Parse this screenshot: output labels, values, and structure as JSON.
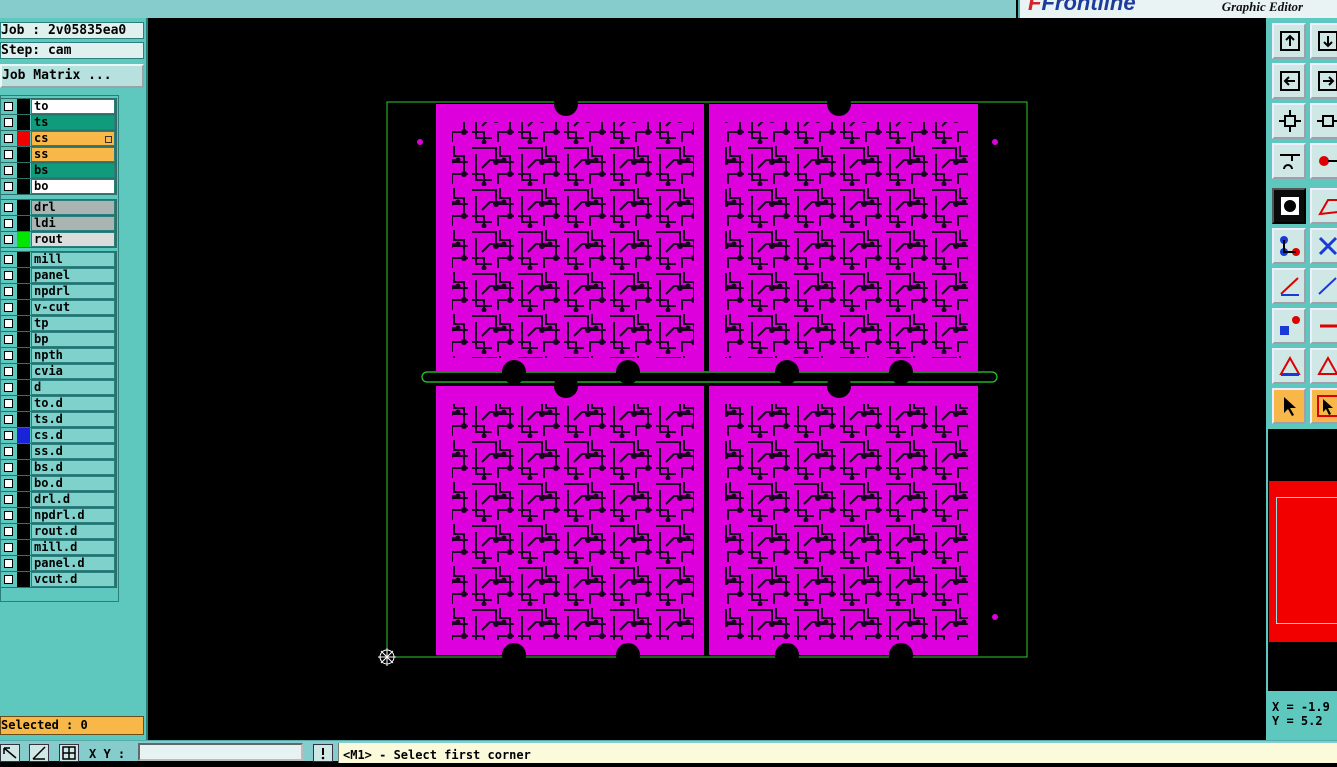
{
  "app": {
    "brand": "Frontline",
    "subtitle": "Graphic Editor"
  },
  "job_info": {
    "job": "Job : 2v05835ea0",
    "step": "Step: cam"
  },
  "job_matrix_button": "Job Matrix ...",
  "layers": [
    {
      "name": "to",
      "bg": "#ffffff",
      "color": "#000000"
    },
    {
      "name": "ts",
      "bg": "#0f9b7c",
      "color": "#000000"
    },
    {
      "name": "cs",
      "bg": "#f7b849",
      "color": "#f20000",
      "marked": true
    },
    {
      "name": "ss",
      "bg": "#f7b849",
      "color": "#000000"
    },
    {
      "name": "bs",
      "bg": "#0f9b7c",
      "color": "#000000"
    },
    {
      "name": "bo",
      "bg": "#ffffff",
      "color": "#000000"
    },
    {
      "name": "drl",
      "bg": "#aab4b3",
      "color": "#000000"
    },
    {
      "name": "ldi",
      "bg": "#aab4b3",
      "color": "#000000"
    },
    {
      "name": "rout",
      "bg": "#dcdcdc",
      "color": "#00e600"
    },
    {
      "name": "mill",
      "bg": "#7fd2cb",
      "color": "#000000"
    },
    {
      "name": "panel",
      "bg": "#7fd2cb",
      "color": "#000000"
    },
    {
      "name": "npdrl",
      "bg": "#7fd2cb",
      "color": "#000000"
    },
    {
      "name": "v-cut",
      "bg": "#7fd2cb",
      "color": "#000000"
    },
    {
      "name": "tp",
      "bg": "#7fd2cb",
      "color": "#000000"
    },
    {
      "name": "bp",
      "bg": "#7fd2cb",
      "color": "#000000"
    },
    {
      "name": "npth",
      "bg": "#7fd2cb",
      "color": "#000000"
    },
    {
      "name": "cvia",
      "bg": "#7fd2cb",
      "color": "#000000"
    },
    {
      "name": "d",
      "bg": "#7fd2cb",
      "color": "#000000"
    },
    {
      "name": "to.d",
      "bg": "#7fd2cb",
      "color": "#000000"
    },
    {
      "name": "ts.d",
      "bg": "#7fd2cb",
      "color": "#000000"
    },
    {
      "name": "cs.d",
      "bg": "#7fd2cb",
      "color": "#1a23d8"
    },
    {
      "name": "ss.d",
      "bg": "#7fd2cb",
      "color": "#000000"
    },
    {
      "name": "bs.d",
      "bg": "#7fd2cb",
      "color": "#000000"
    },
    {
      "name": "bo.d",
      "bg": "#7fd2cb",
      "color": "#000000"
    },
    {
      "name": "drl.d",
      "bg": "#7fd2cb",
      "color": "#000000"
    },
    {
      "name": "npdrl.d",
      "bg": "#7fd2cb",
      "color": "#000000"
    },
    {
      "name": "rout.d",
      "bg": "#7fd2cb",
      "color": "#000000"
    },
    {
      "name": "mill.d",
      "bg": "#7fd2cb",
      "color": "#000000"
    },
    {
      "name": "panel.d",
      "bg": "#7fd2cb",
      "color": "#000000"
    },
    {
      "name": "vcut.d",
      "bg": "#7fd2cb",
      "color": "#000000"
    }
  ],
  "selected_label": "Selected : 0",
  "xy_label": "X Y :",
  "xy_value": "",
  "prompt": "<M1> - Select first corner",
  "coords": {
    "x": "X = -1.9",
    "y": "Y = 5.2"
  },
  "colors": {
    "pcb": "#dd00dd",
    "trace": "#1a0020",
    "outline": "#2ecc2e",
    "map": "#f20000"
  }
}
